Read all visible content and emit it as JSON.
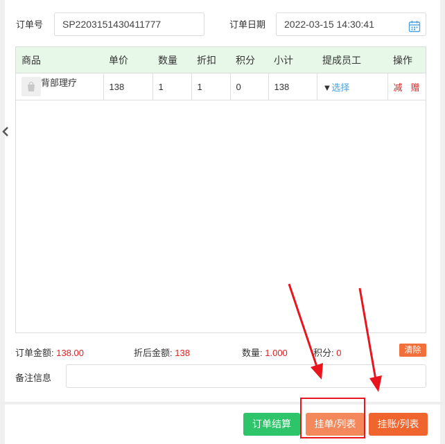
{
  "form": {
    "order_no_label": "订单号",
    "order_no_value": "SP2203151430411777",
    "order_date_label": "订单日期",
    "order_date_value": "2022-03-15 14:30:41"
  },
  "table": {
    "headers": [
      "商品",
      "单价",
      "数量",
      "折扣",
      "积分",
      "小计",
      "提成员工",
      "操作"
    ],
    "rows": [
      {
        "product": "背部理疗",
        "price": "138",
        "qty": "1",
        "discount": "1",
        "points": "0",
        "subtotal": "138",
        "staff_prefix": "▼",
        "staff_select": "选择",
        "op_reduce": "减",
        "op_gift": "赠"
      }
    ]
  },
  "summary": {
    "order_amount_label": "订单金额:",
    "order_amount": "138.00",
    "discounted_label": "折后金额:",
    "discounted": "138",
    "qty_label": "数量:",
    "qty": "1.000",
    "points_label": "积分:",
    "points": "0",
    "clear_label": "清除"
  },
  "remark": {
    "label": "备注信息",
    "value": ""
  },
  "actions": {
    "checkout": "订单结算",
    "hang_order": "挂单/列表",
    "hang_account": "挂账/列表"
  },
  "colors": {
    "header_bg": "#e8f8e8",
    "price_red": "#e02020",
    "link_blue": "#4aa3df",
    "checkout_green": "#2ec46a",
    "hang_orange": "#f5885a",
    "hang_account_orange": "#f0642e",
    "annotation_red": "#e8141e"
  },
  "icons": [
    "chevron-left-icon",
    "calendar-icon",
    "product-bag-icon"
  ]
}
